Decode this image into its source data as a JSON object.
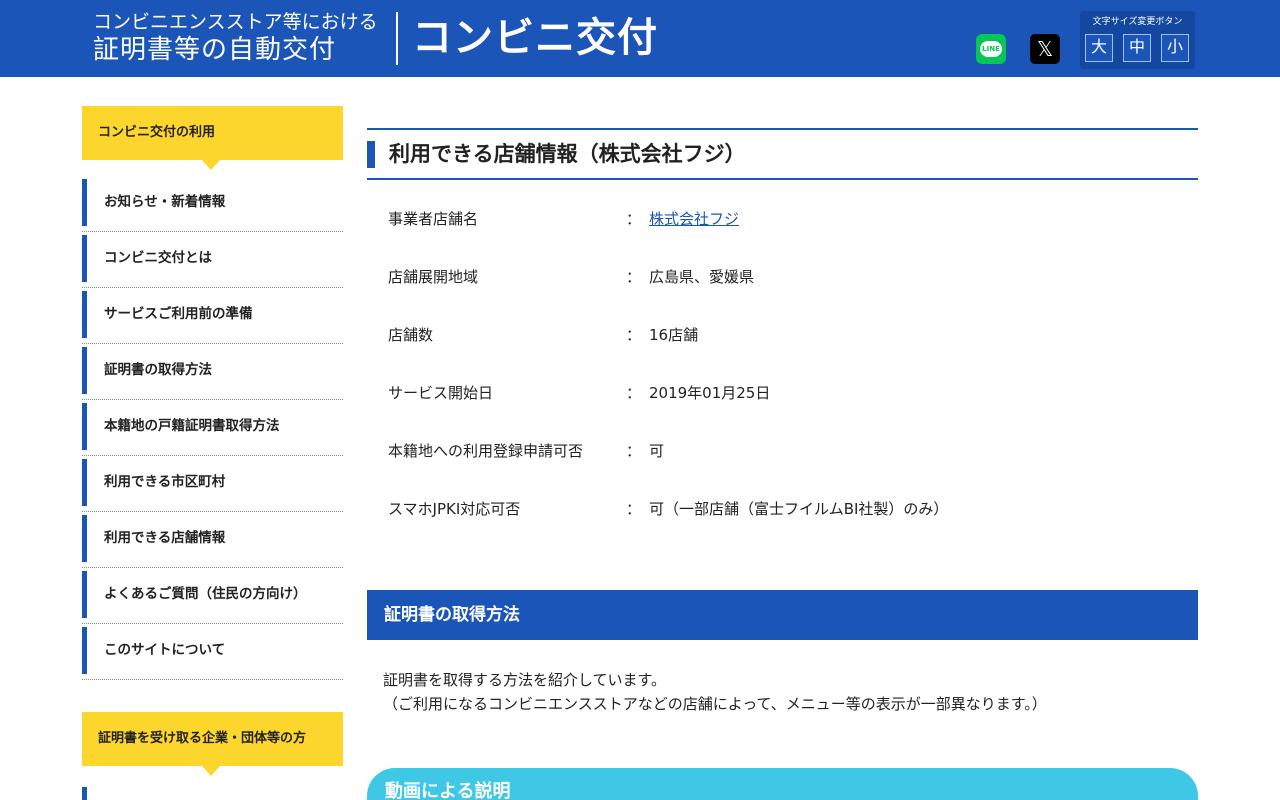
{
  "header": {
    "subtitle_line1": "コンビニエンスストア等における",
    "subtitle_line2": "証明書等の自動交付",
    "site_name": "コンビニ交付",
    "share": {
      "line_label": "LINE",
      "line_icon": "line-icon",
      "x_icon": "x-icon",
      "x_glyph": "𝕏"
    },
    "font_size": {
      "title": "文字サイズ変更ボタン",
      "large": "大",
      "medium": "中",
      "small": "小"
    }
  },
  "sidebar": {
    "section1_title": "コンビニ交付の利用",
    "items": [
      {
        "label": "お知らせ・新着情報"
      },
      {
        "label": "コンビニ交付とは"
      },
      {
        "label": "サービスご利用前の準備"
      },
      {
        "label": "証明書の取得方法"
      },
      {
        "label": "本籍地の戸籍証明書取得方法"
      },
      {
        "label": "利用できる市区町村"
      },
      {
        "label": "利用できる店舗情報"
      },
      {
        "label": "よくあるご質問（住民の方向け）"
      },
      {
        "label": "このサイトについて"
      }
    ],
    "section2_title": "証明書を受け取る企業・団体等の方"
  },
  "main": {
    "title": "利用できる店舗情報（株式会社フジ）",
    "info_rows": [
      {
        "key": "事業者店舗名",
        "colon": "：",
        "value": "株式会社フジ",
        "is_link": true
      },
      {
        "key": "店舗展開地域",
        "colon": "：",
        "value": "広島県、愛媛県"
      },
      {
        "key": "店舗数",
        "colon": "：",
        "value": "16店舗"
      },
      {
        "key": "サービス開始日",
        "colon": "：",
        "value": "2019年01月25日"
      },
      {
        "key": "本籍地への利用登録申請可否",
        "colon": "：",
        "value": "可"
      },
      {
        "key": "スマホJPKI対応可否",
        "colon": "：",
        "value": "可（一部店舗（富士フイルムBI社製）のみ）"
      }
    ],
    "section_title": "証明書の取得方法",
    "section_text_line1": "証明書を取得する方法を紹介しています。",
    "section_text_line2": "（ご利用になるコンビニエンスストアなどの店舗によって、メニュー等の表示が一部異なります。）",
    "video_title": "動画による説明"
  },
  "colors": {
    "brand_blue": "#1b55b8",
    "sidebar_yellow": "#fdd62d",
    "video_cyan": "#3fc8e6",
    "line_green": "#06c755"
  }
}
